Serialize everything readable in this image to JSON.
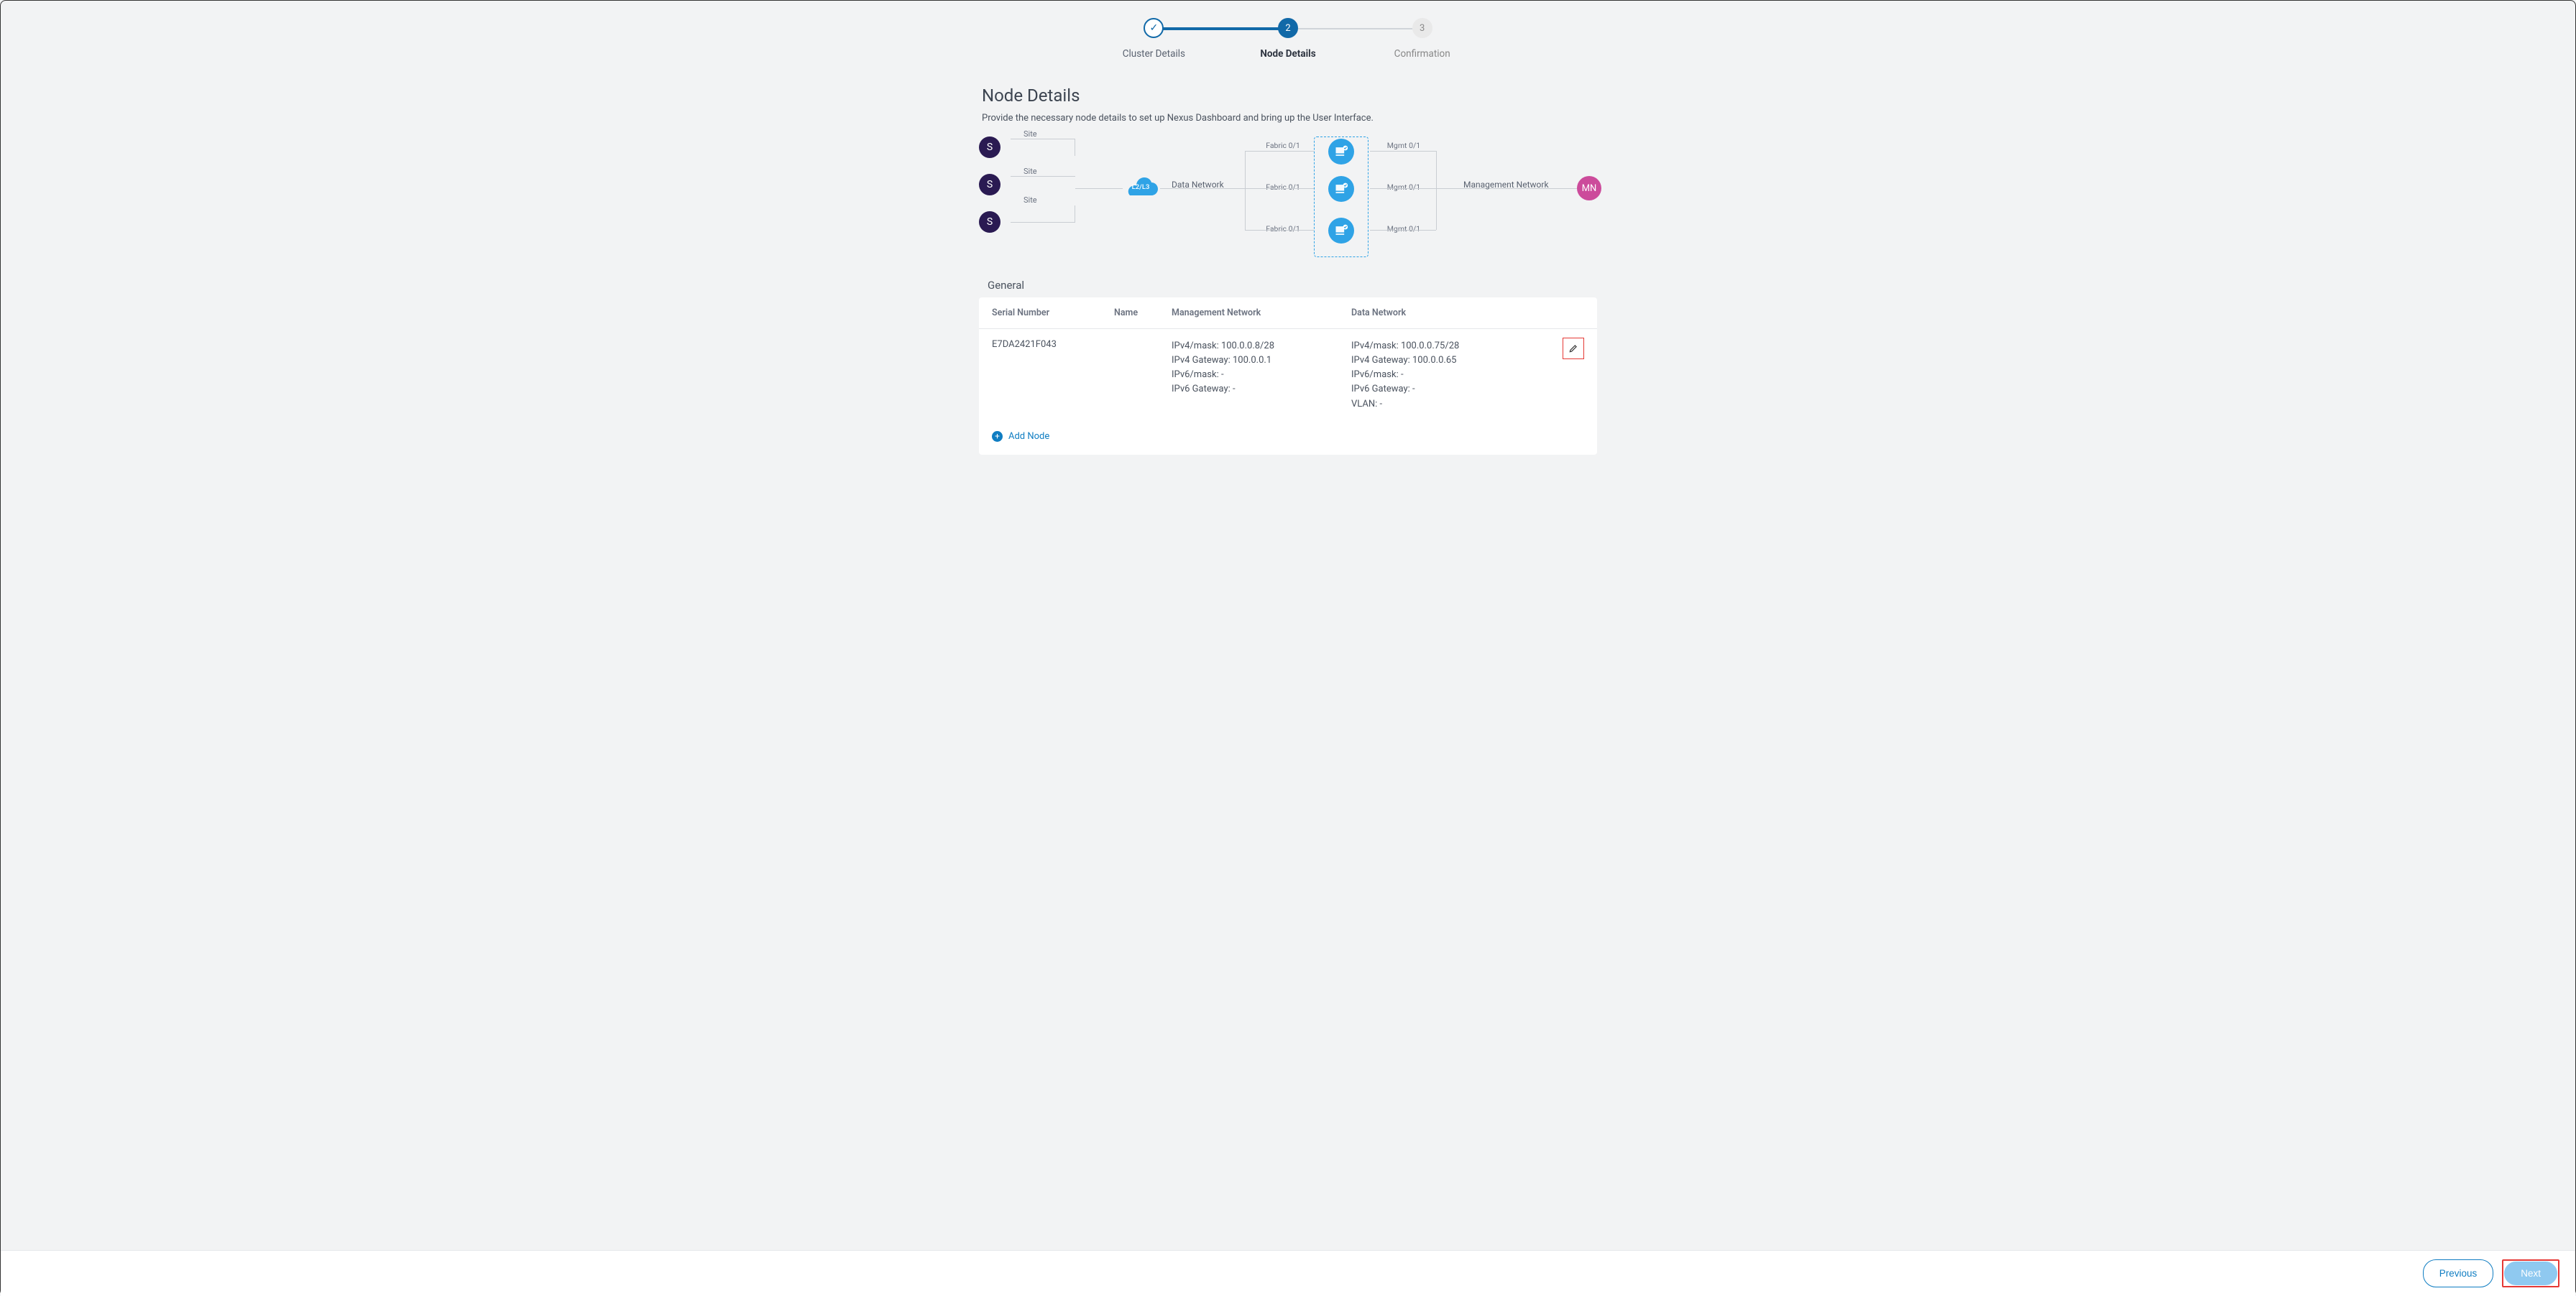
{
  "stepper": {
    "steps": [
      {
        "label": "Cluster Details",
        "state": "done"
      },
      {
        "label": "Node Details",
        "num": "2",
        "state": "current"
      },
      {
        "label": "Confirmation",
        "num": "3",
        "state": "future"
      }
    ]
  },
  "page": {
    "title": "Node Details",
    "subtitle": "Provide the necessary node details to set up Nexus Dashboard and bring up the User Interface."
  },
  "diagram": {
    "site_letter": "S",
    "site_label": "Site",
    "cloud_label": "L2/L3",
    "data_network_label": "Data Network",
    "fabric_label": "Fabric 0/1",
    "mgmt_label": "Mgmt 0/1",
    "management_network_label": "Management Network",
    "mn_letters": "MN"
  },
  "general": {
    "section_label": "General",
    "columns": {
      "serial": "Serial Number",
      "name": "Name",
      "mgmt": "Management Network",
      "data": "Data Network"
    },
    "rows": [
      {
        "serial": "E7DA2421F043",
        "name": "",
        "mgmt": {
          "ipv4_mask": "IPv4/mask: 100.0.0.8/28",
          "ipv4_gw": "IPv4 Gateway: 100.0.0.1",
          "ipv6_mask": "IPv6/mask: -",
          "ipv6_gw": "IPv6 Gateway: -"
        },
        "data": {
          "ipv4_mask": "IPv4/mask: 100.0.0.75/28",
          "ipv4_gw": "IPv4 Gateway: 100.0.0.65",
          "ipv6_mask": "IPv6/mask: -",
          "ipv6_gw": "IPv6 Gateway: -",
          "vlan": "VLAN: -"
        }
      }
    ],
    "add_node_label": "Add Node"
  },
  "footer": {
    "previous": "Previous",
    "next": "Next"
  }
}
